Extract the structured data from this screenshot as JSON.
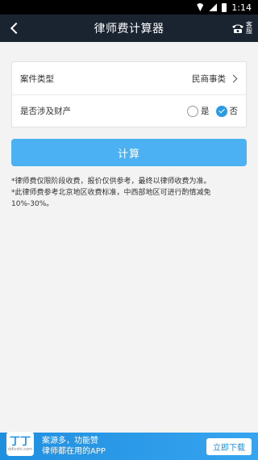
{
  "status_bar": {
    "time": "1:14"
  },
  "header": {
    "title": "律师费计算器",
    "service_label": "客服"
  },
  "form": {
    "case_type_label": "案件类型",
    "case_type_value": "民商事类",
    "property_label": "是否涉及财产",
    "options": [
      {
        "label": "是",
        "checked": false
      },
      {
        "label": "否",
        "checked": true
      }
    ]
  },
  "calc_button": "计算",
  "notes": [
    "*律师费仅限阶段收费，报价仅供参考，最终以律师收费为准。",
    "*此律师费参考北京地区收费标准，中西部地区可进行酌情减免10%-30%。"
  ],
  "ad": {
    "logo_text": "丁丁",
    "logo_sub": "ddlvshi.com",
    "line1": "案源多，功能赞",
    "line2": "律师都在用的APP",
    "button": "立即下载"
  },
  "colors": {
    "header": "#1a2330",
    "accent": "#2a9be5",
    "button": "#4cb1f2"
  }
}
